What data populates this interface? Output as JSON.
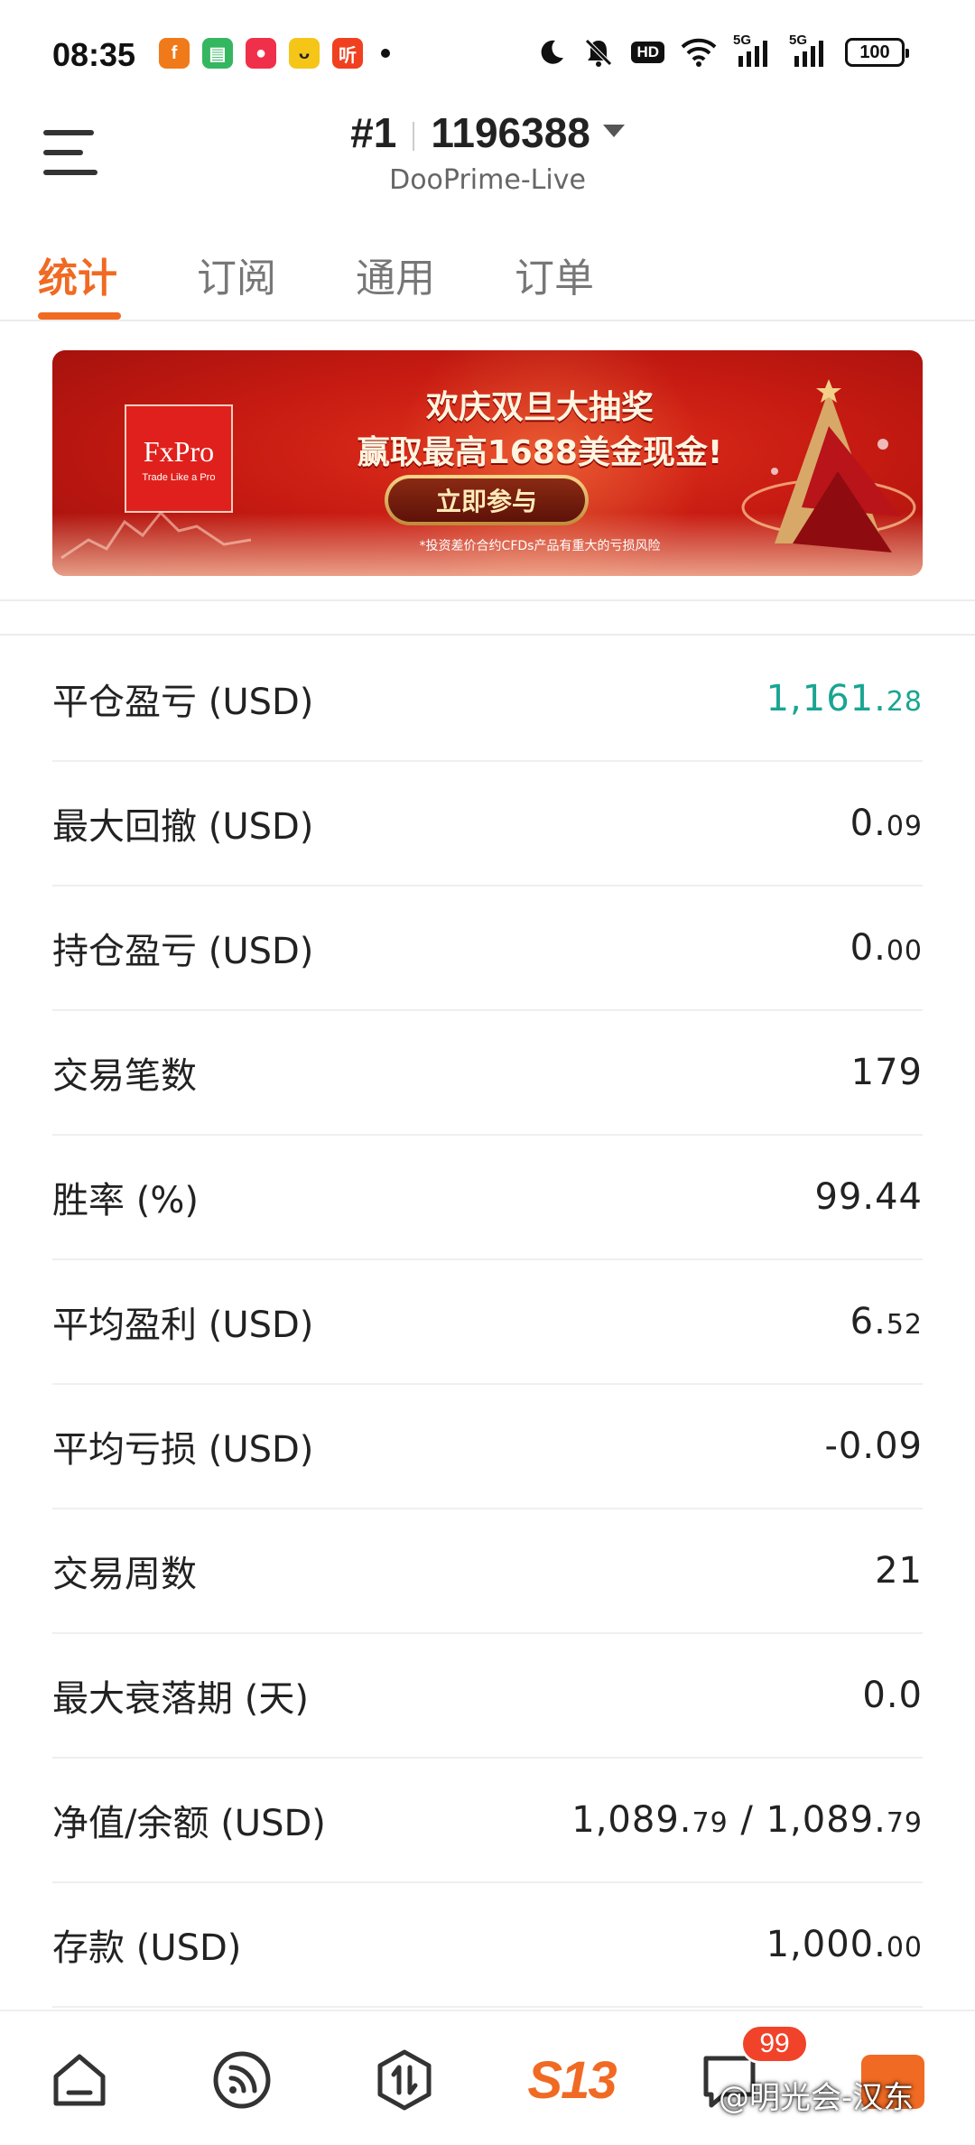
{
  "status_bar": {
    "time": "08:35",
    "notifications": [
      {
        "icon": "orange-app-icon",
        "glyph": "f",
        "color": "#f07a1a"
      },
      {
        "icon": "green-chat-icon",
        "glyph": "▤",
        "color": "#34b760"
      },
      {
        "icon": "red-video-icon",
        "glyph": "●",
        "color": "#f0304a"
      },
      {
        "icon": "yellow-bunny-icon",
        "glyph": "ᴗ",
        "color": "#f5c518"
      },
      {
        "icon": "red-listen-icon",
        "glyph": "听",
        "color": "#f04020"
      }
    ],
    "hd_label": "HD",
    "signal_1_label": "5G",
    "signal_2_label": "5G",
    "battery": "100"
  },
  "header": {
    "account_index": "#1",
    "account_number": "1196388",
    "server": "DooPrime-Live"
  },
  "tabs": [
    {
      "label": "统计",
      "active": true
    },
    {
      "label": "订阅",
      "active": false
    },
    {
      "label": "通用",
      "active": false
    },
    {
      "label": "订单",
      "active": false
    }
  ],
  "banner": {
    "brand": "FxPro",
    "brand_tagline": "Trade Like a Pro",
    "headline": "欢庆双旦大抽奖",
    "subheadline": "赢取最高1688美金现金!",
    "cta": "立即参与",
    "disclaimer": "*投资差价合约CFDs产品有重大的亏损风险"
  },
  "stats": [
    {
      "label": "平仓盈亏 (USD)",
      "value_int": "1,161.",
      "value_dec": "28",
      "positive": true
    },
    {
      "label": "最大回撤 (USD)",
      "value_int": "0.",
      "value_dec": "09"
    },
    {
      "label": "持仓盈亏 (USD)",
      "value_int": "0.",
      "value_dec": "00"
    },
    {
      "label": "交易笔数",
      "value_int": "179",
      "value_dec": ""
    },
    {
      "label": "胜率 (%)",
      "value_int": "99.44",
      "value_dec": ""
    },
    {
      "label": "平均盈利 (USD)",
      "value_int": "6.",
      "value_dec": "52"
    },
    {
      "label": "平均亏损 (USD)",
      "value_int": "-0.09",
      "value_dec": ""
    },
    {
      "label": "交易周数",
      "value_int": "21",
      "value_dec": ""
    },
    {
      "label": "最大衰落期 (天)",
      "value_int": "0.0",
      "value_dec": ""
    },
    {
      "label": "净值/余额 (USD)",
      "value_int": "1,089.",
      "value_dec": "79",
      "value_int2": " / 1,089.",
      "value_dec2": "79"
    },
    {
      "label": "存款 (USD)",
      "value_int": "1,000.",
      "value_dec": "00"
    }
  ],
  "bottom_nav": {
    "items": [
      "home-icon",
      "feed-icon",
      "trade-icon",
      "s13-logo",
      "message-icon",
      "profile-icon"
    ],
    "s13_label": "S13",
    "message_badge": "99",
    "watermark": "@明光会-汉东"
  },
  "colors": {
    "accent": "#f06a23",
    "positive": "#1aa592",
    "banner_red": "#c81b12"
  }
}
